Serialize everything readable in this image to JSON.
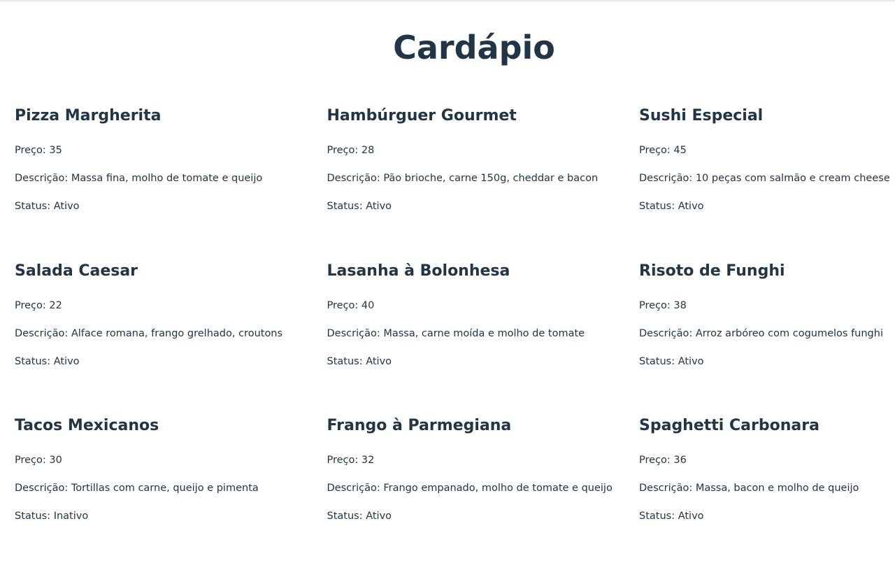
{
  "page": {
    "title": "Cardápio"
  },
  "menu": {
    "items": [
      {
        "name": "Pizza Margherita",
        "price": "Preço: 35",
        "description": "Descrição: Massa fina, molho de tomate e queijo",
        "status": "Status: Ativo"
      },
      {
        "name": "Hambúrguer Gourmet",
        "price": "Preço: 28",
        "description": "Descrição: Pão brioche, carne 150g, cheddar e bacon",
        "status": "Status: Ativo"
      },
      {
        "name": "Sushi Especial",
        "price": "Preço: 45",
        "description": "Descrição: 10 peças com salmão e cream cheese",
        "status": "Status: Ativo"
      },
      {
        "name": "Salada Caesar",
        "price": "Preço: 22",
        "description": "Descrição: Alface romana, frango grelhado, croutons",
        "status": "Status: Ativo"
      },
      {
        "name": "Lasanha à Bolonhesa",
        "price": "Preço: 40",
        "description": "Descrição: Massa, carne moída e molho de tomate",
        "status": "Status: Ativo"
      },
      {
        "name": "Risoto de Funghi",
        "price": "Preço: 38",
        "description": "Descrição: Arroz arbóreo com cogumelos funghi",
        "status": "Status: Ativo"
      },
      {
        "name": "Tacos Mexicanos",
        "price": "Preço: 30",
        "description": "Descrição: Tortillas com carne, queijo e pimenta",
        "status": "Status: Inativo"
      },
      {
        "name": "Frango à Parmegiana",
        "price": "Preço: 32",
        "description": "Descrição: Frango empanado, molho de tomate e queijo",
        "status": "Status: Ativo"
      },
      {
        "name": "Spaghetti Carbonara",
        "price": "Preço: 36",
        "description": "Descrição: Massa, bacon e molho de queijo",
        "status": "Status: Ativo"
      }
    ]
  },
  "colors": {
    "text": "#213547",
    "background": "#ffffff",
    "divider": "#e6e9ec"
  }
}
